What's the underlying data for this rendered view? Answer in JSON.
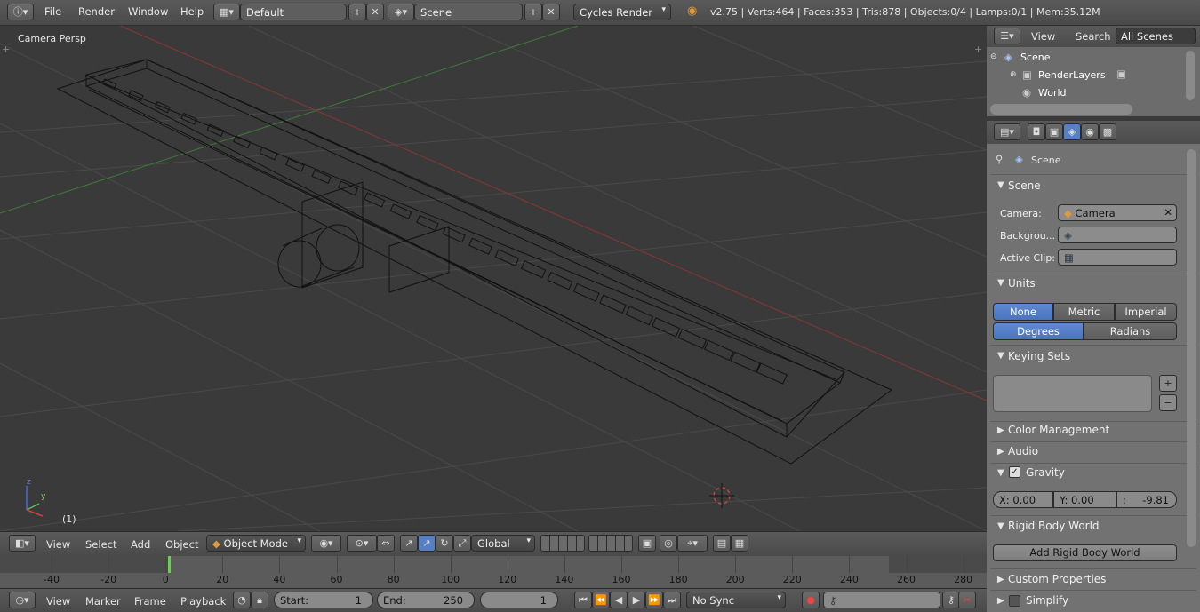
{
  "topbar": {
    "menus": [
      "File",
      "Render",
      "Window",
      "Help"
    ],
    "layout": "Default",
    "scene": "Scene",
    "engine": "Cycles Render",
    "stats": "v2.75 | Verts:464 | Faces:353 | Tris:878 | Objects:0/4 | Lamps:0/1 | Mem:35.12M"
  },
  "viewport": {
    "label": "Camera Persp",
    "frame_label": "(1)",
    "axis_y": "y",
    "axis_z": "z"
  },
  "outliner": {
    "view": "View",
    "search": "Search",
    "filter": "All Scenes",
    "items": [
      "Scene",
      "RenderLayers",
      "World"
    ]
  },
  "properties": {
    "context": "Scene",
    "scene_panel": {
      "title": "Scene",
      "camera_label": "Camera:",
      "camera_value": "Camera",
      "background_label": "Backgrou...",
      "clip_label": "Active Clip:"
    },
    "units": {
      "title": "Units",
      "systems": [
        "None",
        "Metric",
        "Imperial"
      ],
      "rotation": [
        "Degrees",
        "Radians"
      ]
    },
    "keying_title": "Keying Sets",
    "color_management": "Color Management",
    "audio": "Audio",
    "gravity": {
      "title": "Gravity",
      "x": "X: 0.00",
      "y": "Y:  0.00",
      "z_label": ":",
      "z_value": "-9.81"
    },
    "rigid_body": {
      "title": "Rigid Body World",
      "button": "Add Rigid Body World"
    },
    "custom_props": "Custom Properties",
    "simplify": "Simplify"
  },
  "header3d": {
    "menus": [
      "View",
      "Select",
      "Add",
      "Object"
    ],
    "mode": "Object Mode",
    "orientation": "Global"
  },
  "timeline": {
    "ticks": [
      "-40",
      "-20",
      "0",
      "20",
      "40",
      "60",
      "80",
      "100",
      "120",
      "140",
      "160",
      "180",
      "200",
      "220",
      "240",
      "260",
      "280"
    ],
    "current_frame": 1
  },
  "timeline_header": {
    "menus": [
      "View",
      "Marker",
      "Frame",
      "Playback"
    ],
    "start_label": "Start:",
    "start_value": "1",
    "end_label": "End:",
    "end_value": "250",
    "current": "1",
    "sync": "No Sync"
  }
}
